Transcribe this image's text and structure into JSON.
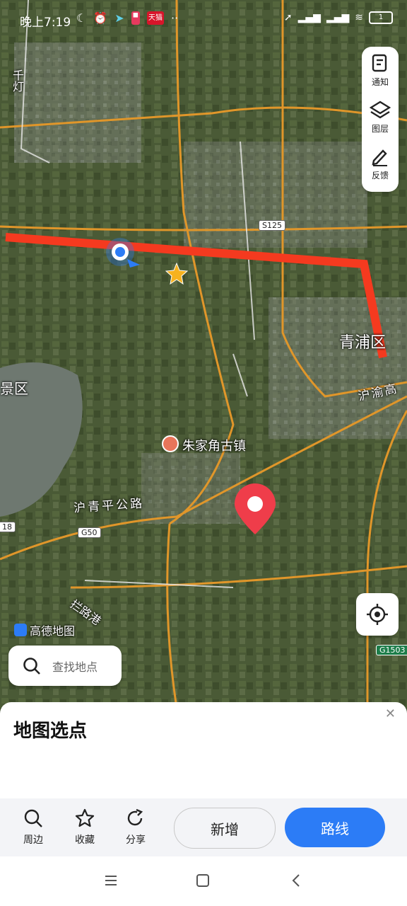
{
  "status_bar": {
    "time": "晚上7:19",
    "app_badge_1": "天猫",
    "battery": "1"
  },
  "side_panel": {
    "notice": "通知",
    "layers": "图层",
    "feedback": "反馈"
  },
  "map": {
    "labels": {
      "qingpu": "青浦区",
      "zhujiajiao": "朱家角古镇",
      "huqingping": "沪青平公路",
      "huyu": "沪渝高",
      "jingqu": "景区",
      "qiandeng": "千灯",
      "lanluogang": "拦路港",
      "watermark": "高德地图"
    },
    "shields": {
      "s125": "S125",
      "g50": "G50",
      "g1503": "G1503",
      "left_18": "18"
    },
    "route_color": "#f53a1f",
    "pin_color": "#ef3d4a"
  },
  "search": {
    "placeholder": "查找地点"
  },
  "sheet": {
    "title": "地图选点"
  },
  "actions": {
    "nearby": "周边",
    "favorite": "收藏",
    "share": "分享",
    "add_new": "新增",
    "route": "路线"
  }
}
